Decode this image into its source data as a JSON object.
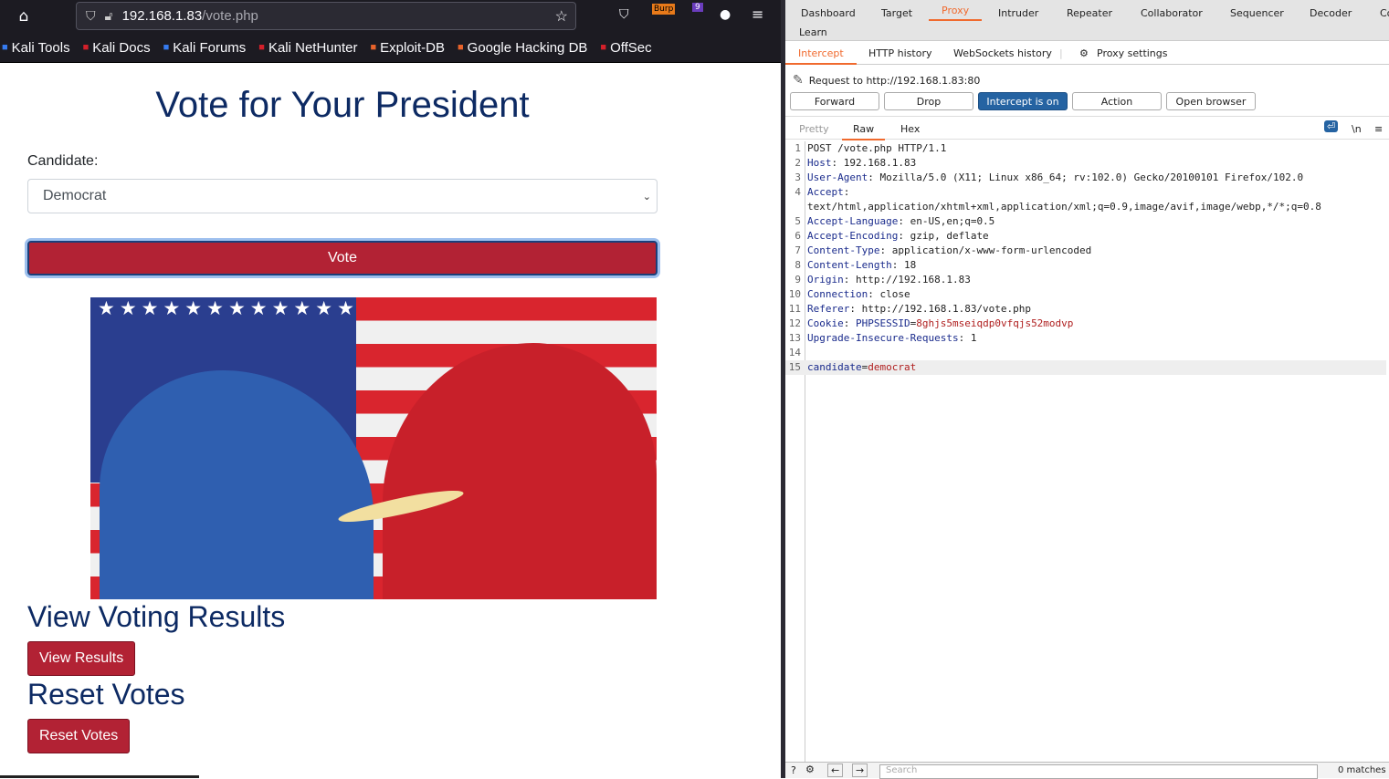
{
  "browser": {
    "url_host": "192.168.1.83",
    "url_path": "/vote.php",
    "bookmarks": [
      {
        "label": "Kali Tools",
        "color": "#367bf0"
      },
      {
        "label": "Kali Docs",
        "color": "#d4202a"
      },
      {
        "label": "Kali Forums",
        "color": "#367bf0"
      },
      {
        "label": "Kali NetHunter",
        "color": "#d4202a"
      },
      {
        "label": "Exploit-DB",
        "color": "#e8632b"
      },
      {
        "label": "Google Hacking DB",
        "color": "#e8632b"
      },
      {
        "label": "OffSec",
        "color": "#d4202a"
      }
    ],
    "extensions": {
      "burp_label": "Burp",
      "badge_count": "9"
    }
  },
  "page": {
    "title": "Vote for Your President",
    "candidate_label": "Candidate:",
    "candidate_selected": "Democrat",
    "vote_label": "Vote",
    "results_heading": "View Voting Results",
    "results_button": "View Results",
    "reset_heading": "Reset Votes",
    "reset_button": "Reset Votes",
    "accent": "#b22234",
    "heading_color": "#0d2a63"
  },
  "burp": {
    "main_tabs": [
      "Dashboard",
      "Target",
      "Proxy",
      "Intruder",
      "Repeater",
      "Collaborator",
      "Sequencer",
      "Decoder",
      "Co",
      "Learn"
    ],
    "active_main_tab": "Proxy",
    "sub_tabs": [
      "Intercept",
      "HTTP history",
      "WebSockets history",
      "Proxy settings"
    ],
    "request_to": "Request to http://192.168.1.83:80",
    "buttons": [
      "Forward",
      "Drop",
      "Intercept is on",
      "Action",
      "Open browser"
    ],
    "view_tabs": [
      "Pretty",
      "Raw",
      "Hex"
    ],
    "wrap_label": "\\n",
    "lines": [
      {
        "n": "1",
        "plain": "POST /vote.php HTTP/1.1"
      },
      {
        "n": "2",
        "key": "Host",
        "val": " 192.168.1.83"
      },
      {
        "n": "3",
        "key": "User-Agent",
        "val": " Mozilla/5.0 (X11; Linux x86_64; rv:102.0) Gecko/20100101 Firefox/102.0"
      },
      {
        "n": "4",
        "key": "Accept",
        "val": ""
      },
      {
        "n": "",
        "plain": "text/html,application/xhtml+xml,application/xml;q=0.9,image/avif,image/webp,*/*;q=0.8"
      },
      {
        "n": "5",
        "key": "Accept-Language",
        "val": " en-US,en;q=0.5"
      },
      {
        "n": "6",
        "key": "Accept-Encoding",
        "val": " gzip, deflate"
      },
      {
        "n": "7",
        "key": "Content-Type",
        "val": " application/x-www-form-urlencoded"
      },
      {
        "n": "8",
        "key": "Content-Length",
        "val": " 18"
      },
      {
        "n": "9",
        "key": "Origin",
        "val": " http://192.168.1.83"
      },
      {
        "n": "10",
        "key": "Connection",
        "val": " close"
      },
      {
        "n": "11",
        "key": "Referer",
        "val": " http://192.168.1.83/vote.php"
      },
      {
        "n": "12",
        "key": "Cookie",
        "val": " ",
        "ckey": "PHPSESSID",
        "cval": "8ghjs5mseiqdp0vfqjs52modvp"
      },
      {
        "n": "13",
        "key": "Upgrade-Insecure-Requests",
        "val": " 1"
      },
      {
        "n": "14",
        "plain": ""
      },
      {
        "n": "15",
        "pkey": "candidate",
        "pval": "democrat"
      }
    ],
    "search_placeholder": "Search",
    "matches": "0 matches"
  }
}
